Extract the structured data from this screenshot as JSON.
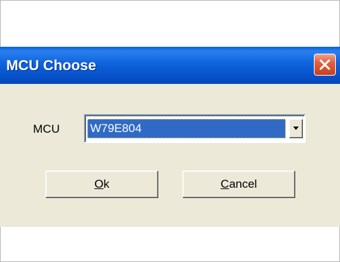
{
  "dialog": {
    "title": "MCU Choose",
    "close_icon": "close-icon",
    "mcu_label": "MCU",
    "mcu_select": {
      "selected": "W79E804"
    },
    "ok_button": {
      "mnemonic": "O",
      "rest": "k"
    },
    "cancel_button": {
      "mnemonic": "C",
      "rest": "ancel"
    }
  }
}
